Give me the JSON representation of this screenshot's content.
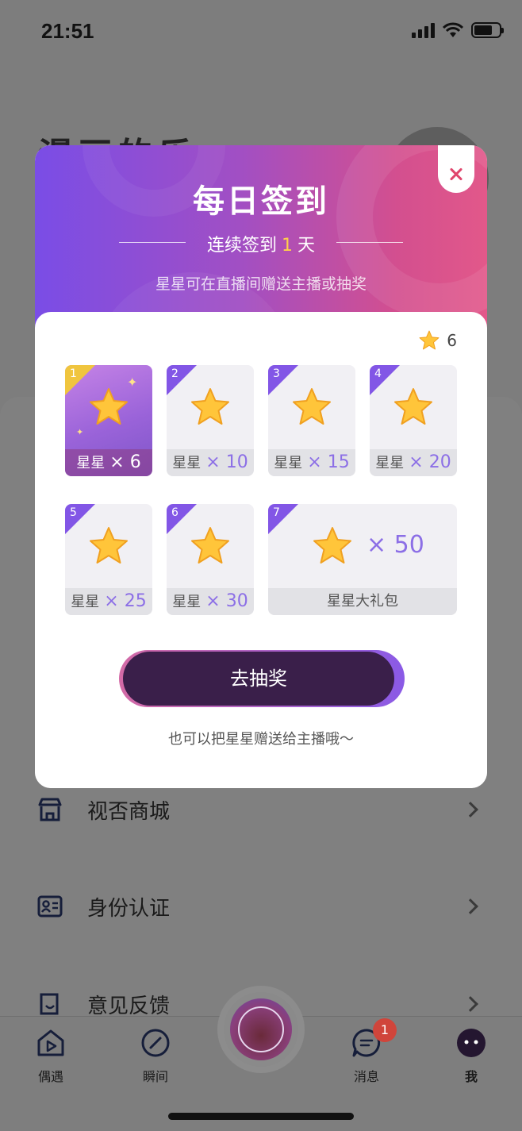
{
  "status": {
    "time": "21:51"
  },
  "background": {
    "title": "漫画的乐",
    "menu": [
      {
        "label": "视否商城",
        "icon": "store-icon"
      },
      {
        "label": "身份认证",
        "icon": "id-card-icon"
      },
      {
        "label": "意见反馈",
        "icon": "feedback-icon"
      }
    ]
  },
  "tabbar": {
    "items": [
      {
        "label": "偶遇",
        "icon": "encounter-icon"
      },
      {
        "label": "瞬间",
        "icon": "moment-icon"
      },
      {
        "label": "消息",
        "icon": "message-icon",
        "badge": "1"
      },
      {
        "label": "我",
        "icon": "profile-icon"
      }
    ]
  },
  "modal": {
    "title": "每日签到",
    "streak_prefix": "连续签到",
    "streak_days": "1",
    "streak_suffix": "天",
    "subtitle": "星星可在直播间赠送主播或抽奖",
    "balance": "6",
    "days": [
      {
        "day": "1",
        "label": "星星",
        "mult": "× 6",
        "active": true
      },
      {
        "day": "2",
        "label": "星星",
        "mult": "× 10"
      },
      {
        "day": "3",
        "label": "星星",
        "mult": "× 15"
      },
      {
        "day": "4",
        "label": "星星",
        "mult": "× 20"
      },
      {
        "day": "5",
        "label": "星星",
        "mult": "× 25"
      },
      {
        "day": "6",
        "label": "星星",
        "mult": "× 30"
      },
      {
        "day": "7",
        "label": "星星大礼包",
        "mult": "× 50"
      }
    ],
    "button_label": "去抽奖",
    "hint": "也可以把星星赠送给主播哦～"
  },
  "colors": {
    "accent": "#8c6fe6",
    "header_start": "#7a4de6",
    "header_end": "#e2588a",
    "button": "#3a1f4a",
    "badge": "#d0453b",
    "streak_number": "#ffcf4a"
  }
}
